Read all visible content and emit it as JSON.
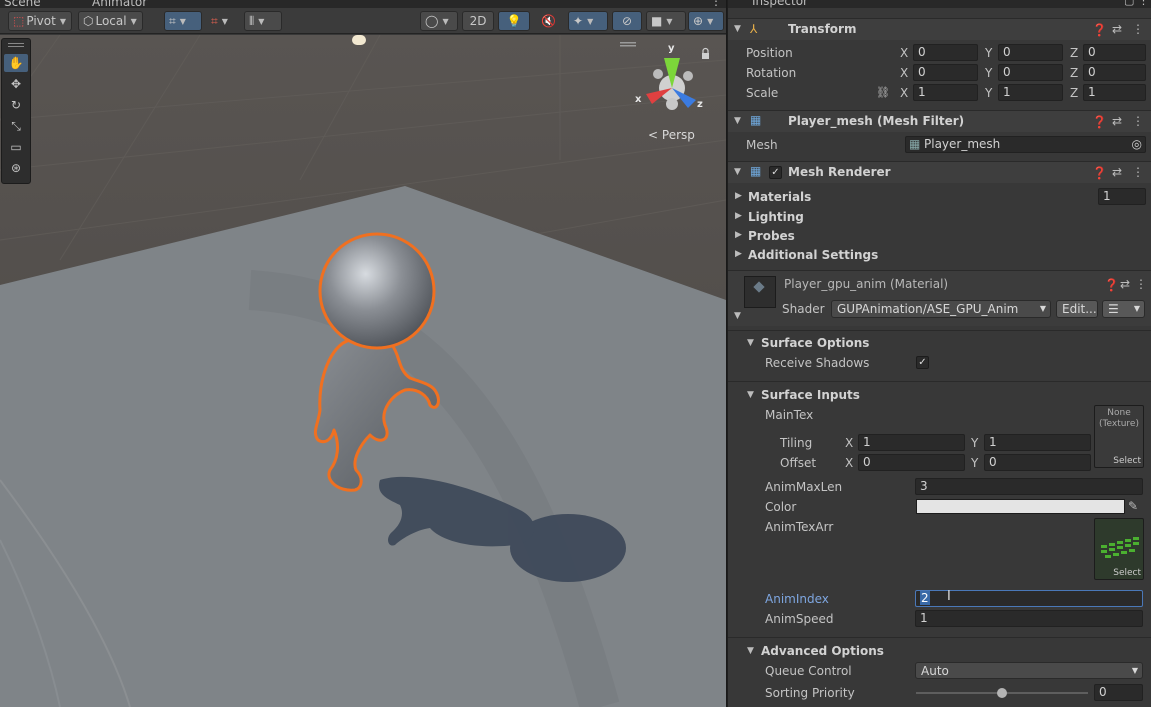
{
  "tabs": {
    "scene": "Scene",
    "animator": "Animator",
    "inspector": "Inspector"
  },
  "toolbar": {
    "pivot": "Pivot",
    "local": "Local",
    "mode_2d": "2D"
  },
  "scene": {
    "persp": "Persp",
    "gizmo": {
      "y": "y",
      "x": "x",
      "z": "z"
    }
  },
  "transform": {
    "title": "Transform",
    "rows": [
      {
        "label": "Position",
        "x": "0",
        "y": "0",
        "z": "0"
      },
      {
        "label": "Rotation",
        "x": "0",
        "y": "0",
        "z": "0"
      },
      {
        "label": "Scale",
        "x": "1",
        "y": "1",
        "z": "1"
      }
    ],
    "axis": {
      "x": "X",
      "y": "Y",
      "z": "Z"
    }
  },
  "mesh_filter": {
    "title": "Player_mesh (Mesh Filter)",
    "mesh_label": "Mesh",
    "mesh_value": "Player_mesh"
  },
  "mesh_renderer": {
    "title": "Mesh Renderer",
    "materials": "Materials",
    "materials_count": "1",
    "lighting": "Lighting",
    "probes": "Probes",
    "additional": "Additional Settings"
  },
  "material": {
    "title": "Player_gpu_anim (Material)",
    "shader_label": "Shader",
    "shader_value": "GUPAnimation/ASE_GPU_Anim",
    "edit": "Edit..."
  },
  "surface_options": {
    "title": "Surface Options",
    "receive_shadows": "Receive Shadows"
  },
  "surface_inputs": {
    "title": "Surface Inputs",
    "maintex": "MainTex",
    "tex_none": "None",
    "tex_type": "(Texture)",
    "select": "Select",
    "tiling": "Tiling",
    "tiling_x": "1",
    "tiling_y": "1",
    "offset": "Offset",
    "offset_x": "0",
    "offset_y": "0",
    "animmaxlen": "AnimMaxLen",
    "animmaxlen_value": "3",
    "color": "Color",
    "animtexarr": "AnimTexArr",
    "animindex": "AnimIndex",
    "animindex_value": "2",
    "animspeed": "AnimSpeed",
    "animspeed_value": "1"
  },
  "advanced": {
    "title": "Advanced Options",
    "queue": "Queue Control",
    "queue_value": "Auto",
    "sorting": "Sorting Priority",
    "sorting_value": "0",
    "sorting_level": 0.5
  },
  "colors": {
    "accent": "#46607c",
    "selection": "#f07020",
    "field": "#2a2a2a",
    "panel": "#383838"
  }
}
